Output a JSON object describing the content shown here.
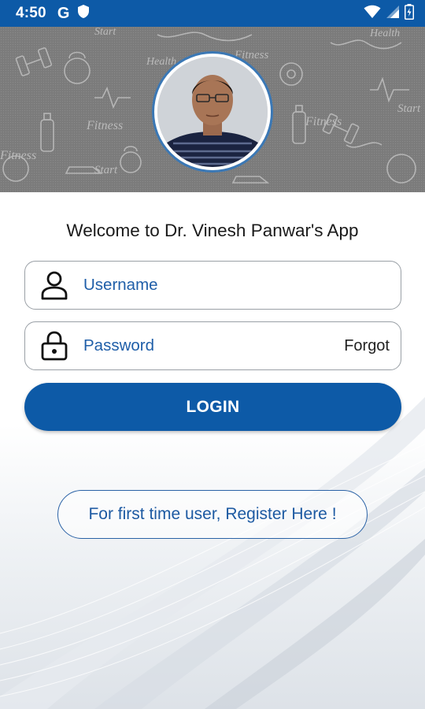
{
  "status_bar": {
    "time": "4:50",
    "left_icons": [
      "google-icon",
      "shield-icon"
    ],
    "right_icons": [
      "wifi-icon",
      "signal-icon",
      "battery-icon"
    ],
    "background_color": "#0d5aa7"
  },
  "header": {
    "banner_icon": "fitness-doodle-pattern",
    "profile_photo": "doctor-profile-photo"
  },
  "welcome": {
    "title": "Welcome to Dr. Vinesh Panwar's App"
  },
  "form": {
    "username": {
      "placeholder": "Username",
      "value": "",
      "icon": "person-icon"
    },
    "password": {
      "placeholder": "Password",
      "value": "",
      "icon": "lock-icon",
      "forgot_label": "Forgot"
    },
    "login_label": "LOGIN",
    "register_label": "For first time user, Register Here !"
  },
  "colors": {
    "primary": "#0d5aa7",
    "banner_gray": "#7a7a7a",
    "field_border": "#9aa0a6"
  }
}
